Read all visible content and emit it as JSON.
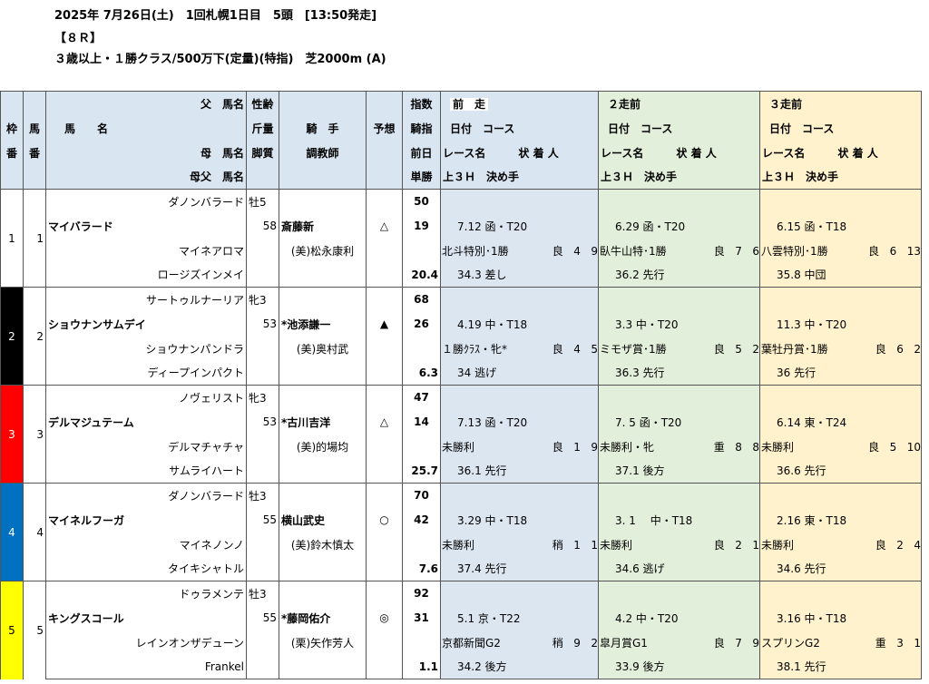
{
  "header": {
    "line1": "2025年 7月26日(土)　1回札幌1日目　5頭　[13:50発走]",
    "line2": "【８Ｒ】",
    "line3": "３歳以上・１勝クラス/500万下(定量)(特指)　芝2000m (A)"
  },
  "columns": {
    "waku": [
      "枠",
      "番"
    ],
    "uma": [
      "馬",
      "番"
    ],
    "father_label": "父　馬名",
    "horse_label": "馬　　名",
    "mother_label": "母　馬名",
    "mf_label": "母父　馬名",
    "sexage": [
      "性齢",
      "斤量",
      "脚質"
    ],
    "jockey": "騎　手",
    "trainer": "調教師",
    "yoso": "予想",
    "index": [
      "指数",
      "騎指",
      "前日",
      "単勝"
    ],
    "prev1": "前　走",
    "prev2": "２走前",
    "prev3": "３走前",
    "date_course": "日付　コース",
    "race_line": "レース名　　　状 着 人",
    "last3f": "上３Ｈ　決め手"
  },
  "colors": {
    "waku1": "#ffffff",
    "waku2": "#000000",
    "waku3": "#ff0000",
    "waku4": "#0070c0",
    "waku5": "#ffff00",
    "prev1_bg": "#dce6f1",
    "prev2_bg": "#e2efda",
    "prev3_bg": "#fff2cc",
    "header_bg": "#d9e6f2"
  },
  "horses": [
    {
      "waku": "1",
      "uma": "1",
      "father": "ダノンバラード",
      "name": "マイバラード",
      "mother": "マイネアロマ",
      "mf": "ロージズインメイ",
      "sexage": "牡5",
      "weight": "58",
      "jockey": "斎藤新",
      "trainer": "(美)松永康利",
      "mark": "△",
      "idx": "50",
      "jidx": "19",
      "odds": "20.4",
      "p1": {
        "date": "7.12 函・T20",
        "race": "北斗特別･1勝",
        "cond": "良",
        "pos": "4",
        "pop": "9",
        "f3": "34.3",
        "style": "差し"
      },
      "p2": {
        "date": "6.29 函・T20",
        "race": "臥牛山特･1勝",
        "cond": "良",
        "pos": "7",
        "pop": "6",
        "f3": "36.2",
        "style": "先行"
      },
      "p3": {
        "date": "6.15 函・T18",
        "race": "八雲特別･1勝",
        "cond": "良",
        "pos": "6",
        "pop": "13",
        "f3": "35.8",
        "style": "中団"
      }
    },
    {
      "waku": "2",
      "uma": "2",
      "father": "サートゥルナーリア",
      "name": "ショウナンサムデイ",
      "mother": "ショウナンパンドラ",
      "mf": "ディープインパクト",
      "sexage": "牝3",
      "weight": "53",
      "jockey": "*池添謙一",
      "trainer": "(美)奥村武",
      "mark": "▲",
      "idx": "68",
      "jidx": "26",
      "odds": "6.3",
      "p1": {
        "date": "4.19 中・T18",
        "race": "１勝ｸﾗｽ・牝*",
        "cond": "良",
        "pos": "4",
        "pop": "5",
        "f3": "34",
        "style": "逃げ"
      },
      "p2": {
        "date": "3.3 中・T20",
        "race": "ミモザ賞･1勝",
        "cond": "良",
        "pos": "5",
        "pop": "2",
        "f3": "36.3",
        "style": "先行"
      },
      "p3": {
        "date": "11.3 中・T20",
        "race": "葉牡丹賞･1勝",
        "cond": "良",
        "pos": "6",
        "pop": "2",
        "f3": "36",
        "style": "先行"
      }
    },
    {
      "waku": "3",
      "uma": "3",
      "father": "ノヴェリスト",
      "name": "デルマジュテーム",
      "mother": "デルマチャチャ",
      "mf": "サムライハート",
      "sexage": "牝3",
      "weight": "53",
      "jockey": "*古川吉洋",
      "trainer": "(美)的場均",
      "mark": "△",
      "idx": "47",
      "jidx": "14",
      "odds": "25.7",
      "p1": {
        "date": "7.13 函・T20",
        "race": "未勝利",
        "cond": "良",
        "pos": "1",
        "pop": "9",
        "f3": "36.1",
        "style": "先行"
      },
      "p2": {
        "date": "7. 5 函・T20",
        "race": "未勝利・牝",
        "cond": "重",
        "pos": "8",
        "pop": "8",
        "f3": "37.1",
        "style": "後方"
      },
      "p3": {
        "date": "6.14 東・T24",
        "race": "未勝利",
        "cond": "良",
        "pos": "5",
        "pop": "10",
        "f3": "36.6",
        "style": "先行"
      }
    },
    {
      "waku": "4",
      "uma": "4",
      "father": "ダノンバラード",
      "name": "マイネルフーガ",
      "mother": "マイネノンノ",
      "mf": "タイキシャトル",
      "sexage": "牡3",
      "weight": "55",
      "jockey": "横山武史",
      "trainer": "(美)鈴木慎太",
      "mark": "○",
      "idx": "70",
      "jidx": "42",
      "odds": "7.6",
      "p1": {
        "date": "3.29 中・T18",
        "race": "未勝利",
        "cond": "稍",
        "pos": "1",
        "pop": "1",
        "f3": "37.4",
        "style": "先行"
      },
      "p2": {
        "date": "3. 1　 中・T18",
        "race": "未勝利",
        "cond": "良",
        "pos": "2",
        "pop": "1",
        "f3": "34.6",
        "style": "逃げ"
      },
      "p3": {
        "date": "2.16 東・T18",
        "race": "未勝利",
        "cond": "良",
        "pos": "2",
        "pop": "4",
        "f3": "34.6",
        "style": "先行"
      }
    },
    {
      "waku": "5",
      "uma": "5",
      "father": "ドゥラメンテ",
      "name": "キングスコール",
      "mother": "レインオンザデューン",
      "mf": "Frankel",
      "sexage": "牡3",
      "weight": "55",
      "jockey": "*藤岡佑介",
      "trainer": "(栗)矢作芳人",
      "mark": "◎",
      "idx": "92",
      "jidx": "31",
      "odds": "1.1",
      "p1": {
        "date": "5.1 京・T22",
        "race": "京都新聞G2",
        "cond": "稍",
        "pos": "9",
        "pop": "2",
        "f3": "34.2",
        "style": "後方"
      },
      "p2": {
        "date": "4.2 中・T20",
        "race": "皐月賞G1",
        "cond": "良",
        "pos": "7",
        "pop": "9",
        "f3": "33.9",
        "style": "後方"
      },
      "p3": {
        "date": "3.16 中・T18",
        "race": "スプリンG2",
        "cond": "重",
        "pos": "3",
        "pop": "1",
        "f3": "38.1",
        "style": "先行"
      }
    }
  ]
}
